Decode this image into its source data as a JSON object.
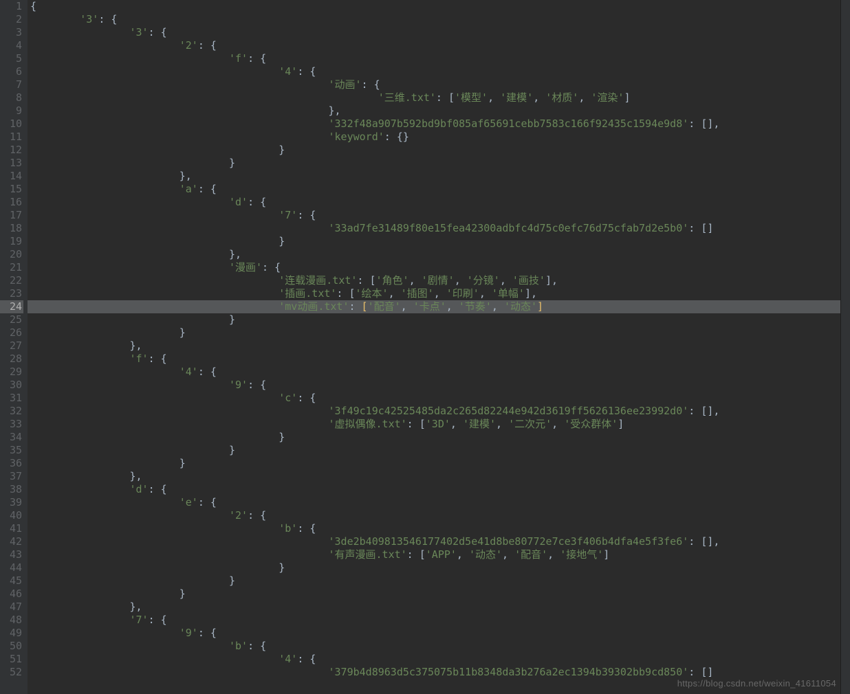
{
  "editor": {
    "highlighted_line": 24,
    "watermark": "https://blog.csdn.net/weixin_41611054",
    "lines": [
      {
        "n": 1,
        "indent": 0,
        "segs": [
          {
            "t": "{",
            "c": "punc"
          }
        ]
      },
      {
        "n": 2,
        "indent": 1,
        "segs": [
          {
            "t": "'3'",
            "c": "str"
          },
          {
            "t": ": {",
            "c": "punc"
          }
        ]
      },
      {
        "n": 3,
        "indent": 2,
        "segs": [
          {
            "t": "'3'",
            "c": "str"
          },
          {
            "t": ": {",
            "c": "punc"
          }
        ]
      },
      {
        "n": 4,
        "indent": 3,
        "segs": [
          {
            "t": "'2'",
            "c": "str"
          },
          {
            "t": ": {",
            "c": "punc"
          }
        ]
      },
      {
        "n": 5,
        "indent": 4,
        "segs": [
          {
            "t": "'f'",
            "c": "str"
          },
          {
            "t": ": {",
            "c": "punc"
          }
        ]
      },
      {
        "n": 6,
        "indent": 5,
        "segs": [
          {
            "t": "'4'",
            "c": "str"
          },
          {
            "t": ": {",
            "c": "punc"
          }
        ]
      },
      {
        "n": 7,
        "indent": 6,
        "segs": [
          {
            "t": "'动画'",
            "c": "str"
          },
          {
            "t": ": {",
            "c": "punc"
          }
        ]
      },
      {
        "n": 8,
        "indent": 7,
        "segs": [
          {
            "t": "'三维.txt'",
            "c": "str"
          },
          {
            "t": ": [",
            "c": "punc"
          },
          {
            "t": "'模型'",
            "c": "str"
          },
          {
            "t": ", ",
            "c": "punc"
          },
          {
            "t": "'建模'",
            "c": "str"
          },
          {
            "t": ", ",
            "c": "punc"
          },
          {
            "t": "'材质'",
            "c": "str"
          },
          {
            "t": ", ",
            "c": "punc"
          },
          {
            "t": "'渲染'",
            "c": "str"
          },
          {
            "t": "]",
            "c": "punc"
          }
        ]
      },
      {
        "n": 9,
        "indent": 6,
        "segs": [
          {
            "t": "},",
            "c": "punc"
          }
        ]
      },
      {
        "n": 10,
        "indent": 6,
        "segs": [
          {
            "t": "'332f48a907b592bd9bf085af65691cebb7583c166f92435c1594e9d8'",
            "c": "str"
          },
          {
            "t": ": [],",
            "c": "punc"
          }
        ]
      },
      {
        "n": 11,
        "indent": 6,
        "segs": [
          {
            "t": "'keyword'",
            "c": "str"
          },
          {
            "t": ": {}",
            "c": "punc"
          }
        ]
      },
      {
        "n": 12,
        "indent": 5,
        "segs": [
          {
            "t": "}",
            "c": "punc"
          }
        ]
      },
      {
        "n": 13,
        "indent": 4,
        "segs": [
          {
            "t": "}",
            "c": "punc"
          }
        ]
      },
      {
        "n": 14,
        "indent": 3,
        "segs": [
          {
            "t": "},",
            "c": "punc"
          }
        ]
      },
      {
        "n": 15,
        "indent": 3,
        "segs": [
          {
            "t": "'a'",
            "c": "str"
          },
          {
            "t": ": {",
            "c": "punc"
          }
        ]
      },
      {
        "n": 16,
        "indent": 4,
        "segs": [
          {
            "t": "'d'",
            "c": "str"
          },
          {
            "t": ": {",
            "c": "punc"
          }
        ]
      },
      {
        "n": 17,
        "indent": 5,
        "segs": [
          {
            "t": "'7'",
            "c": "str"
          },
          {
            "t": ": {",
            "c": "punc"
          }
        ]
      },
      {
        "n": 18,
        "indent": 6,
        "segs": [
          {
            "t": "'33ad7fe31489f80e15fea42300adbfc4d75c0efc76d75cfab7d2e5b0'",
            "c": "str"
          },
          {
            "t": ": []",
            "c": "punc"
          }
        ]
      },
      {
        "n": 19,
        "indent": 5,
        "segs": [
          {
            "t": "}",
            "c": "punc"
          }
        ]
      },
      {
        "n": 20,
        "indent": 4,
        "segs": [
          {
            "t": "},",
            "c": "punc"
          }
        ]
      },
      {
        "n": 21,
        "indent": 4,
        "segs": [
          {
            "t": "'漫画'",
            "c": "str"
          },
          {
            "t": ": {",
            "c": "punc"
          }
        ]
      },
      {
        "n": 22,
        "indent": 5,
        "segs": [
          {
            "t": "'连载漫画.txt'",
            "c": "str"
          },
          {
            "t": ": [",
            "c": "punc"
          },
          {
            "t": "'角色'",
            "c": "str"
          },
          {
            "t": ", ",
            "c": "punc"
          },
          {
            "t": "'剧情'",
            "c": "str"
          },
          {
            "t": ", ",
            "c": "punc"
          },
          {
            "t": "'分镜'",
            "c": "str"
          },
          {
            "t": ", ",
            "c": "punc"
          },
          {
            "t": "'画技'",
            "c": "str"
          },
          {
            "t": "],",
            "c": "punc"
          }
        ]
      },
      {
        "n": 23,
        "indent": 5,
        "segs": [
          {
            "t": "'插画.txt'",
            "c": "str"
          },
          {
            "t": ": [",
            "c": "punc"
          },
          {
            "t": "'绘本'",
            "c": "str"
          },
          {
            "t": ", ",
            "c": "punc"
          },
          {
            "t": "'插图'",
            "c": "str"
          },
          {
            "t": ", ",
            "c": "punc"
          },
          {
            "t": "'印刷'",
            "c": "str"
          },
          {
            "t": ", ",
            "c": "punc"
          },
          {
            "t": "'单幅'",
            "c": "str"
          },
          {
            "t": "],",
            "c": "punc"
          }
        ]
      },
      {
        "n": 24,
        "indent": 5,
        "segs": [
          {
            "t": "'mv动画.txt'",
            "c": "str"
          },
          {
            "t": ": ",
            "c": "punc"
          },
          {
            "t": "[",
            "c": "bracket-match"
          },
          {
            "t": "'配音'",
            "c": "str"
          },
          {
            "t": ", ",
            "c": "punc"
          },
          {
            "t": "'卡点'",
            "c": "str"
          },
          {
            "t": ", ",
            "c": "punc"
          },
          {
            "t": "'节奏'",
            "c": "str"
          },
          {
            "t": ", ",
            "c": "punc"
          },
          {
            "t": "'动态'",
            "c": "str"
          },
          {
            "t": "]",
            "c": "bracket-match"
          }
        ]
      },
      {
        "n": 25,
        "indent": 4,
        "segs": [
          {
            "t": "}",
            "c": "punc"
          }
        ]
      },
      {
        "n": 26,
        "indent": 3,
        "segs": [
          {
            "t": "}",
            "c": "punc"
          }
        ]
      },
      {
        "n": 27,
        "indent": 2,
        "segs": [
          {
            "t": "},",
            "c": "punc"
          }
        ]
      },
      {
        "n": 28,
        "indent": 2,
        "segs": [
          {
            "t": "'f'",
            "c": "str"
          },
          {
            "t": ": {",
            "c": "punc"
          }
        ]
      },
      {
        "n": 29,
        "indent": 3,
        "segs": [
          {
            "t": "'4'",
            "c": "str"
          },
          {
            "t": ": {",
            "c": "punc"
          }
        ]
      },
      {
        "n": 30,
        "indent": 4,
        "segs": [
          {
            "t": "'9'",
            "c": "str"
          },
          {
            "t": ": {",
            "c": "punc"
          }
        ]
      },
      {
        "n": 31,
        "indent": 5,
        "segs": [
          {
            "t": "'c'",
            "c": "str"
          },
          {
            "t": ": {",
            "c": "punc"
          }
        ]
      },
      {
        "n": 32,
        "indent": 6,
        "segs": [
          {
            "t": "'3f49c19c42525485da2c265d82244e942d3619ff5626136ee23992d0'",
            "c": "str"
          },
          {
            "t": ": [],",
            "c": "punc"
          }
        ]
      },
      {
        "n": 33,
        "indent": 6,
        "segs": [
          {
            "t": "'虚拟偶像.txt'",
            "c": "str"
          },
          {
            "t": ": [",
            "c": "punc"
          },
          {
            "t": "'3D'",
            "c": "str"
          },
          {
            "t": ", ",
            "c": "punc"
          },
          {
            "t": "'建模'",
            "c": "str"
          },
          {
            "t": ", ",
            "c": "punc"
          },
          {
            "t": "'二次元'",
            "c": "str"
          },
          {
            "t": ", ",
            "c": "punc"
          },
          {
            "t": "'受众群体'",
            "c": "str"
          },
          {
            "t": "]",
            "c": "punc"
          }
        ]
      },
      {
        "n": 34,
        "indent": 5,
        "segs": [
          {
            "t": "}",
            "c": "punc"
          }
        ]
      },
      {
        "n": 35,
        "indent": 4,
        "segs": [
          {
            "t": "}",
            "c": "punc"
          }
        ]
      },
      {
        "n": 36,
        "indent": 3,
        "segs": [
          {
            "t": "}",
            "c": "punc"
          }
        ]
      },
      {
        "n": 37,
        "indent": 2,
        "segs": [
          {
            "t": "},",
            "c": "punc"
          }
        ]
      },
      {
        "n": 38,
        "indent": 2,
        "segs": [
          {
            "t": "'d'",
            "c": "str"
          },
          {
            "t": ": {",
            "c": "punc"
          }
        ]
      },
      {
        "n": 39,
        "indent": 3,
        "segs": [
          {
            "t": "'e'",
            "c": "str"
          },
          {
            "t": ": {",
            "c": "punc"
          }
        ]
      },
      {
        "n": 40,
        "indent": 4,
        "segs": [
          {
            "t": "'2'",
            "c": "str"
          },
          {
            "t": ": {",
            "c": "punc"
          }
        ]
      },
      {
        "n": 41,
        "indent": 5,
        "segs": [
          {
            "t": "'b'",
            "c": "str"
          },
          {
            "t": ": {",
            "c": "punc"
          }
        ]
      },
      {
        "n": 42,
        "indent": 6,
        "segs": [
          {
            "t": "'3de2b409813546177402d5e41d8be80772e7ce3f406b4dfa4e5f3fe6'",
            "c": "str"
          },
          {
            "t": ": [],",
            "c": "punc"
          }
        ]
      },
      {
        "n": 43,
        "indent": 6,
        "segs": [
          {
            "t": "'有声漫画.txt'",
            "c": "str"
          },
          {
            "t": ": [",
            "c": "punc"
          },
          {
            "t": "'APP'",
            "c": "str"
          },
          {
            "t": ", ",
            "c": "punc"
          },
          {
            "t": "'动态'",
            "c": "str"
          },
          {
            "t": ", ",
            "c": "punc"
          },
          {
            "t": "'配音'",
            "c": "str"
          },
          {
            "t": ", ",
            "c": "punc"
          },
          {
            "t": "'接地气'",
            "c": "str"
          },
          {
            "t": "]",
            "c": "punc"
          }
        ]
      },
      {
        "n": 44,
        "indent": 5,
        "segs": [
          {
            "t": "}",
            "c": "punc"
          }
        ]
      },
      {
        "n": 45,
        "indent": 4,
        "segs": [
          {
            "t": "}",
            "c": "punc"
          }
        ]
      },
      {
        "n": 46,
        "indent": 3,
        "segs": [
          {
            "t": "}",
            "c": "punc"
          }
        ]
      },
      {
        "n": 47,
        "indent": 2,
        "segs": [
          {
            "t": "},",
            "c": "punc"
          }
        ]
      },
      {
        "n": 48,
        "indent": 2,
        "segs": [
          {
            "t": "'7'",
            "c": "str"
          },
          {
            "t": ": {",
            "c": "punc"
          }
        ]
      },
      {
        "n": 49,
        "indent": 3,
        "segs": [
          {
            "t": "'9'",
            "c": "str"
          },
          {
            "t": ": {",
            "c": "punc"
          }
        ]
      },
      {
        "n": 50,
        "indent": 4,
        "segs": [
          {
            "t": "'b'",
            "c": "str"
          },
          {
            "t": ": {",
            "c": "punc"
          }
        ]
      },
      {
        "n": 51,
        "indent": 5,
        "segs": [
          {
            "t": "'4'",
            "c": "str"
          },
          {
            "t": ": {",
            "c": "punc"
          }
        ]
      },
      {
        "n": 52,
        "indent": 6,
        "segs": [
          {
            "t": "'379b4d8963d5c375075b11b8348da3b276a2ec1394b39302bb9cd850'",
            "c": "str"
          },
          {
            "t": ": []",
            "c": "punc"
          }
        ]
      }
    ]
  }
}
